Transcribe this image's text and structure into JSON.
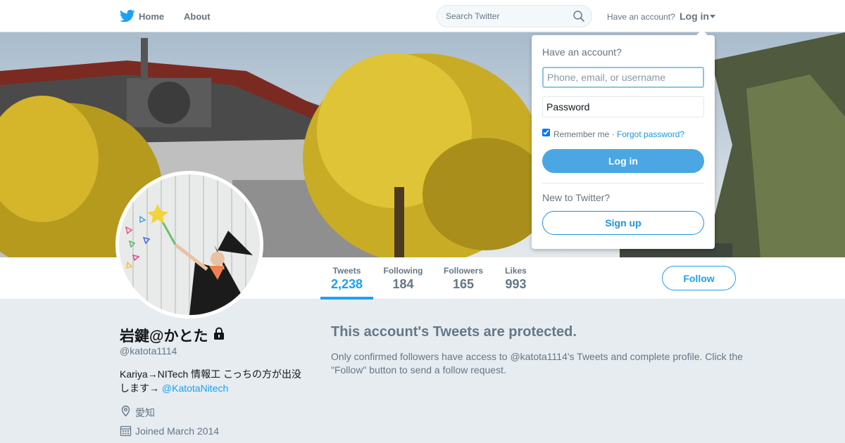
{
  "nav": {
    "logo_icon": "twitter-bird-icon",
    "home_label": "Home",
    "about_label": "About",
    "search_placeholder": "Search Twitter",
    "have_account": "Have an account?",
    "login_label": "Log in"
  },
  "colors": {
    "brand": "#1da1f2",
    "text_secondary": "#657786",
    "background": "#e6ecf0"
  },
  "profile": {
    "name": "岩鍵@かとた",
    "handle": "@katota1114",
    "bio_text": "Kariya→NITech 情報工 こっちの方が出没します→ ",
    "bio_link": "@KatotaNitech",
    "location": "愛知",
    "joined": "Joined March 2014",
    "protected": true
  },
  "stats": [
    {
      "label": "Tweets",
      "value": "2,238",
      "active": true
    },
    {
      "label": "Following",
      "value": "184",
      "active": false
    },
    {
      "label": "Followers",
      "value": "165",
      "active": false
    },
    {
      "label": "Likes",
      "value": "993",
      "active": false
    }
  ],
  "follow_label": "Follow",
  "protected_msg": {
    "title": "This account's Tweets are protected.",
    "body": "Only confirmed followers have access to @katota1114's Tweets and complete profile. Click the \"Follow\" button to send a follow request."
  },
  "login_dropdown": {
    "heading": "Have an account?",
    "username_placeholder": "Phone, email, or username",
    "password_placeholder": "Password",
    "remember_label": "Remember me · ",
    "remember_checked": true,
    "forgot_label": "Forgot password?",
    "login_button": "Log in",
    "new_heading": "New to Twitter?",
    "signup_button": "Sign up"
  }
}
